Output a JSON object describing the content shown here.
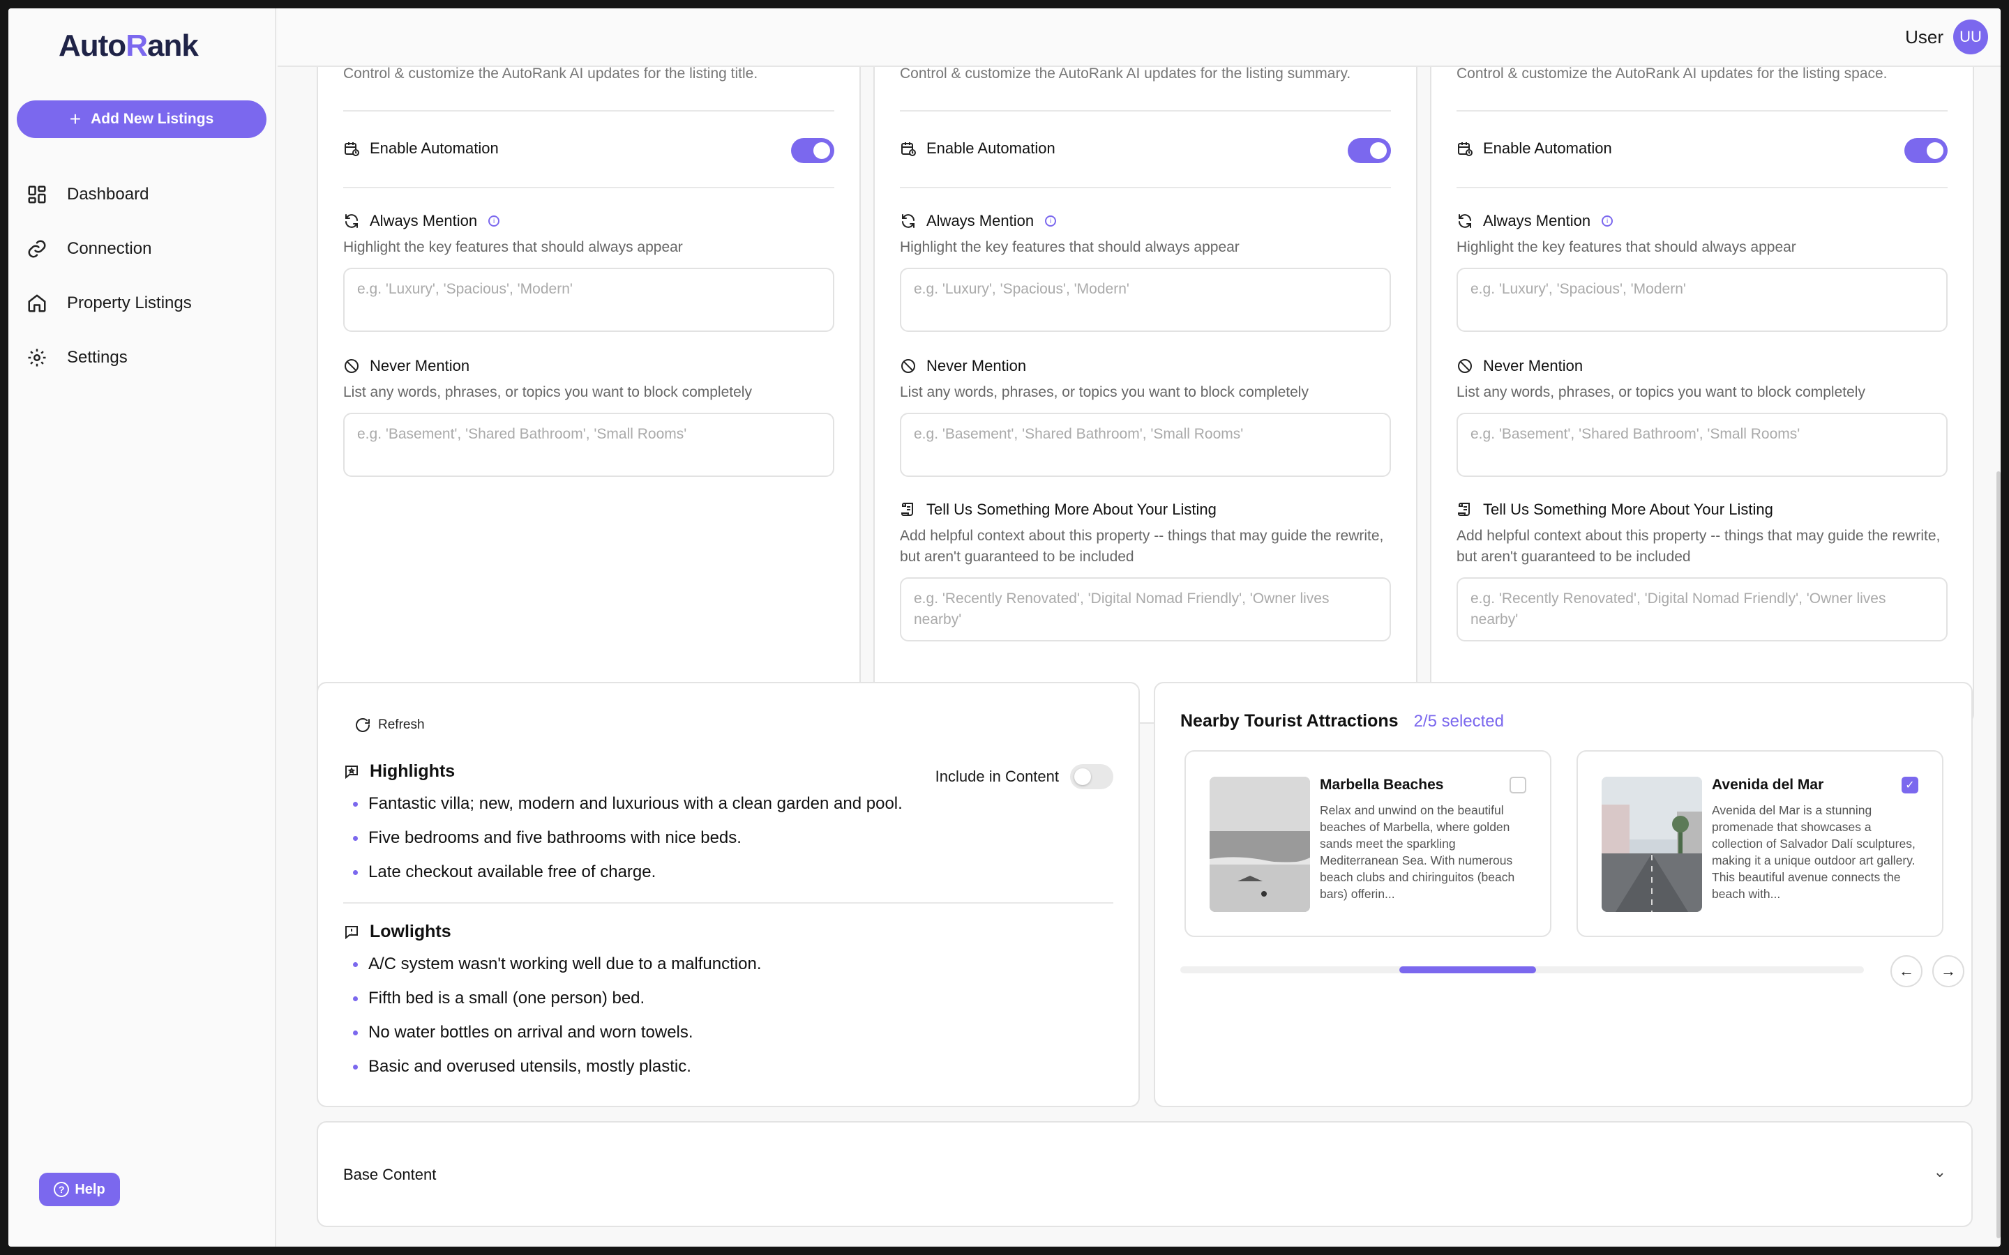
{
  "app": {
    "logo_part1": "Auto",
    "logo_part2": "R",
    "logo_part3": "ank"
  },
  "sidebar": {
    "add_button": "Add New Listings",
    "items": [
      {
        "label": "Dashboard",
        "icon": "dashboard-icon"
      },
      {
        "label": "Connection",
        "icon": "link-icon"
      },
      {
        "label": "Property Listings",
        "icon": "home-icon"
      },
      {
        "label": "Settings",
        "icon": "gear-icon"
      }
    ],
    "help": "Help"
  },
  "topbar": {
    "user_name": "User",
    "avatar_initials": "UU"
  },
  "settings_cards": [
    {
      "desc_top": "Control & customize the AutoRank AI updates for the listing title.",
      "enable_label": "Enable Automation",
      "enabled": true,
      "always_label": "Always Mention",
      "always_help": "Highlight the key features that should always appear",
      "always_placeholder": "e.g. 'Luxury', 'Spacious', 'Modern'",
      "never_label": "Never Mention",
      "never_help": "List any words, phrases, or topics you want to block completely",
      "never_placeholder": "e.g. 'Basement', 'Shared Bathroom', 'Small Rooms'"
    },
    {
      "desc_top": "Control & customize the AutoRank AI updates for the listing summary.",
      "enable_label": "Enable Automation",
      "enabled": true,
      "always_label": "Always Mention",
      "always_help": "Highlight the key features that should always appear",
      "always_placeholder": "e.g. 'Luxury', 'Spacious', 'Modern'",
      "never_label": "Never Mention",
      "never_help": "List any words, phrases, or topics you want to block completely",
      "never_placeholder": "e.g. 'Basement', 'Shared Bathroom', 'Small Rooms'",
      "more_label": "Tell Us Something More About Your Listing",
      "more_help": "Add helpful context about this property -- things that may guide the rewrite, but aren't guaranteed to be included",
      "more_placeholder": "e.g. 'Recently Renovated', 'Digital Nomad Friendly', 'Owner lives nearby'"
    },
    {
      "desc_top": "Control & customize the AutoRank AI updates for the listing space.",
      "enable_label": "Enable Automation",
      "enabled": true,
      "always_label": "Always Mention",
      "always_help": "Highlight the key features that should always appear",
      "always_placeholder": "e.g. 'Luxury', 'Spacious', 'Modern'",
      "never_label": "Never Mention",
      "never_help": "List any words, phrases, or topics you want to block completely",
      "never_placeholder": "e.g. 'Basement', 'Shared Bathroom', 'Small Rooms'",
      "more_label": "Tell Us Something More About Your Listing",
      "more_help": "Add helpful context about this property -- things that may guide the rewrite, but aren't guaranteed to be included",
      "more_placeholder": "e.g. 'Recently Renovated', 'Digital Nomad Friendly', 'Owner lives nearby'"
    }
  ],
  "highlights_card": {
    "refresh": "Refresh",
    "highlights_title": "Highlights",
    "include_label": "Include in Content",
    "include_on": false,
    "highlights": [
      "Fantastic villa; new, modern and luxurious with a clean garden and pool.",
      "Five bedrooms and five bathrooms with nice beds.",
      "Late checkout available free of charge."
    ],
    "lowlights_title": "Lowlights",
    "lowlights": [
      "A/C system wasn't working well due to a malfunction.",
      "Fifth bed is a small (one person) bed.",
      "No water bottles on arrival and worn towels.",
      "Basic and overused utensils, mostly plastic."
    ]
  },
  "attractions": {
    "title": "Nearby Tourist Attractions",
    "selected": "2/5 selected",
    "carousel_position": 0.4,
    "items": [
      {
        "name": "Marbella Beaches",
        "desc": "Relax and unwind on the beautiful beaches of Marbella, where golden sands meet the sparkling Mediterranean Sea. With numerous beach clubs and chiringuitos (beach bars) offerin...",
        "checked": false
      },
      {
        "name": "Avenida del Mar",
        "desc": "Avenida del Mar is a stunning promenade that showcases a collection of Salvador Dalí sculptures, making it a unique outdoor art gallery. This beautiful avenue connects the beach with...",
        "checked": true
      }
    ]
  },
  "base_content": {
    "label": "Base Content"
  },
  "colors": {
    "accent": "#7b68ee",
    "navy": "#1f2347"
  }
}
